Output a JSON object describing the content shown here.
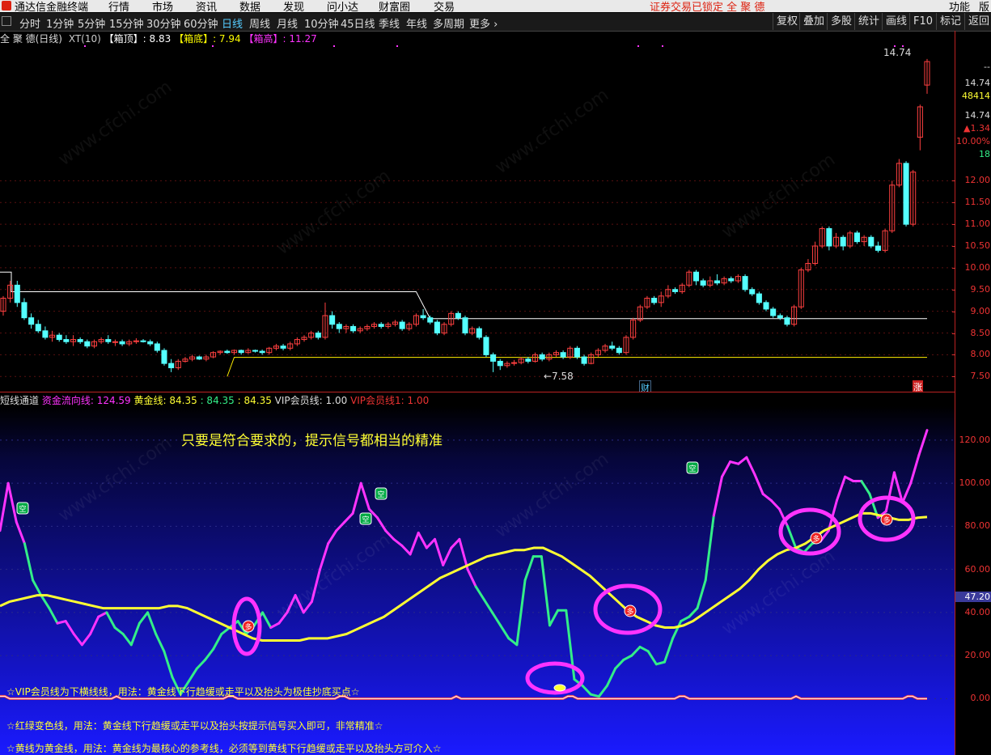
{
  "menu": {
    "app_name": "通达信金融终端",
    "items": [
      "行情",
      "市场",
      "资讯",
      "数据",
      "发现",
      "问小达",
      "财富圈",
      "交易"
    ],
    "status": "证券交易已锁定 全 聚 德",
    "right_items": [
      "功能",
      "版"
    ]
  },
  "toolbar": {
    "periods": [
      "分时",
      "1分钟",
      "5分钟",
      "15分钟",
      "30分钟",
      "60分钟",
      "日线",
      "周线",
      "月线",
      "10分钟",
      "45日线",
      "季线",
      "年线",
      "多周期",
      "更多"
    ],
    "active": "日线",
    "right_buttons": [
      "复权",
      "叠加",
      "多股",
      "统计",
      "画线",
      "F10",
      "标记",
      "返回"
    ]
  },
  "price_header": {
    "name": "全 聚 德(日线)",
    "indicator": "XT(10)",
    "top_label": "【箱顶】",
    "top_value": ": 8.83",
    "bottom_label": "【箱底】",
    "bottom_value": ": 7.94",
    "high_label": "【箱高】",
    "high_value": ": 11.27"
  },
  "price_chart": {
    "ymin": 7.3,
    "ymax": 15.3,
    "high_marker": "14.74",
    "low_marker": "←7.58",
    "event_cai": "财",
    "event_zhang": "涨",
    "box_top": 8.83,
    "box_bottom": 7.94,
    "old_box_top": 9.45,
    "up_color": "#ff4040",
    "down_color": "#54ffff",
    "candles": [
      [
        9.0,
        9.3,
        8.9,
        9.35
      ],
      [
        9.3,
        9.6,
        9.2,
        9.7
      ],
      [
        9.6,
        9.2,
        9.1,
        9.7
      ],
      [
        9.2,
        8.85,
        8.8,
        9.3
      ],
      [
        8.85,
        8.7,
        8.6,
        8.95
      ],
      [
        8.7,
        8.55,
        8.5,
        8.8
      ],
      [
        8.55,
        8.4,
        8.35,
        8.65
      ],
      [
        8.4,
        8.45,
        8.3,
        8.55
      ],
      [
        8.45,
        8.35,
        8.3,
        8.5
      ],
      [
        8.35,
        8.3,
        8.25,
        8.45
      ],
      [
        8.3,
        8.35,
        8.2,
        8.45
      ],
      [
        8.35,
        8.3,
        8.25,
        8.4
      ],
      [
        8.3,
        8.2,
        8.15,
        8.35
      ],
      [
        8.2,
        8.3,
        8.15,
        8.35
      ],
      [
        8.3,
        8.35,
        8.25,
        8.4
      ],
      [
        8.35,
        8.3,
        8.25,
        8.45
      ],
      [
        8.3,
        8.3,
        8.2,
        8.35
      ],
      [
        8.3,
        8.25,
        8.2,
        8.35
      ],
      [
        8.25,
        8.3,
        8.2,
        8.35
      ],
      [
        8.3,
        8.32,
        8.25,
        8.38
      ],
      [
        8.32,
        8.3,
        8.28,
        8.36
      ],
      [
        8.3,
        8.25,
        8.2,
        8.35
      ],
      [
        8.25,
        8.1,
        8.05,
        8.3
      ],
      [
        8.1,
        7.8,
        7.75,
        8.15
      ],
      [
        7.8,
        7.7,
        7.6,
        7.9
      ],
      [
        7.7,
        7.85,
        7.65,
        7.9
      ],
      [
        7.85,
        7.9,
        7.82,
        7.95
      ],
      [
        7.9,
        7.95,
        7.85,
        8.0
      ],
      [
        7.95,
        7.9,
        7.88,
        7.98
      ],
      [
        7.9,
        7.95,
        7.85,
        8.0
      ],
      [
        7.95,
        8.05,
        7.92,
        8.08
      ],
      [
        8.05,
        8.08,
        8.0,
        8.1
      ],
      [
        8.08,
        8.05,
        8.02,
        8.12
      ],
      [
        8.05,
        8.1,
        8.0,
        8.12
      ],
      [
        8.1,
        8.05,
        8.0,
        8.12
      ],
      [
        8.05,
        8.1,
        8.02,
        8.15
      ],
      [
        8.1,
        8.08,
        8.05,
        8.12
      ],
      [
        8.08,
        8.05,
        8.0,
        8.12
      ],
      [
        8.05,
        8.15,
        8.0,
        8.18
      ],
      [
        8.15,
        8.2,
        8.1,
        8.25
      ],
      [
        8.2,
        8.15,
        8.1,
        8.25
      ],
      [
        8.15,
        8.25,
        8.1,
        8.3
      ],
      [
        8.25,
        8.35,
        8.2,
        8.4
      ],
      [
        8.35,
        8.4,
        8.3,
        8.45
      ],
      [
        8.4,
        8.5,
        8.35,
        8.55
      ],
      [
        8.5,
        8.4,
        8.35,
        8.55
      ],
      [
        8.4,
        8.9,
        8.35,
        9.2
      ],
      [
        8.9,
        8.7,
        8.6,
        9.0
      ],
      [
        8.7,
        8.6,
        8.5,
        8.75
      ],
      [
        8.6,
        8.65,
        8.5,
        8.7
      ],
      [
        8.65,
        8.55,
        8.5,
        8.7
      ],
      [
        8.55,
        8.6,
        8.5,
        8.65
      ],
      [
        8.6,
        8.65,
        8.55,
        8.7
      ],
      [
        8.65,
        8.7,
        8.6,
        8.75
      ],
      [
        8.7,
        8.65,
        8.6,
        8.75
      ],
      [
        8.65,
        8.7,
        8.6,
        8.75
      ],
      [
        8.7,
        8.75,
        8.65,
        8.8
      ],
      [
        8.75,
        8.6,
        8.55,
        8.8
      ],
      [
        8.6,
        8.7,
        8.55,
        8.75
      ],
      [
        8.7,
        8.9,
        8.65,
        8.95
      ],
      [
        8.9,
        8.85,
        8.8,
        9.05
      ],
      [
        8.85,
        8.75,
        8.7,
        8.9
      ],
      [
        8.75,
        8.5,
        8.45,
        8.8
      ],
      [
        8.5,
        8.7,
        8.45,
        8.75
      ],
      [
        8.7,
        8.95,
        8.65,
        9.0
      ],
      [
        8.95,
        8.85,
        8.8,
        9.0
      ],
      [
        8.85,
        8.5,
        8.45,
        8.9
      ],
      [
        8.5,
        8.6,
        8.45,
        8.65
      ],
      [
        8.6,
        8.4,
        8.35,
        8.65
      ],
      [
        8.4,
        8.0,
        7.95,
        8.45
      ],
      [
        8.0,
        7.85,
        7.6,
        8.05
      ],
      [
        7.85,
        7.75,
        7.65,
        7.9
      ],
      [
        7.75,
        7.8,
        7.7,
        7.85
      ],
      [
        7.8,
        7.82,
        7.75,
        7.88
      ],
      [
        7.82,
        7.9,
        7.78,
        7.95
      ],
      [
        7.9,
        7.85,
        7.8,
        7.95
      ],
      [
        7.85,
        8.0,
        7.82,
        8.05
      ],
      [
        8.0,
        7.9,
        7.85,
        8.05
      ],
      [
        7.9,
        8.0,
        7.85,
        8.05
      ],
      [
        8.0,
        8.05,
        7.95,
        8.1
      ],
      [
        8.05,
        7.95,
        7.9,
        8.1
      ],
      [
        7.95,
        8.15,
        7.9,
        8.2
      ],
      [
        8.15,
        7.95,
        7.9,
        8.2
      ],
      [
        7.95,
        7.8,
        7.75,
        8.0
      ],
      [
        7.8,
        8.0,
        7.78,
        8.05
      ],
      [
        8.0,
        8.1,
        7.95,
        8.15
      ],
      [
        8.1,
        8.2,
        8.05,
        8.25
      ],
      [
        8.2,
        8.15,
        8.1,
        8.3
      ],
      [
        8.15,
        8.05,
        8.0,
        8.2
      ],
      [
        8.05,
        8.4,
        8.0,
        8.45
      ],
      [
        8.4,
        8.8,
        8.35,
        8.85
      ],
      [
        8.8,
        9.1,
        8.75,
        9.15
      ],
      [
        9.1,
        9.3,
        9.05,
        9.35
      ],
      [
        9.3,
        9.2,
        9.15,
        9.35
      ],
      [
        9.2,
        9.35,
        9.1,
        9.45
      ],
      [
        9.35,
        9.5,
        9.3,
        9.6
      ],
      [
        9.5,
        9.45,
        9.4,
        9.55
      ],
      [
        9.45,
        9.6,
        9.4,
        9.65
      ],
      [
        9.6,
        9.9,
        9.55,
        9.95
      ],
      [
        9.9,
        9.7,
        9.6,
        9.95
      ],
      [
        9.7,
        9.6,
        9.55,
        9.75
      ],
      [
        9.6,
        9.7,
        9.55,
        9.8
      ],
      [
        9.7,
        9.65,
        9.6,
        9.85
      ],
      [
        9.65,
        9.75,
        9.6,
        9.8
      ],
      [
        9.75,
        9.7,
        9.65,
        9.8
      ],
      [
        9.7,
        9.8,
        9.65,
        9.85
      ],
      [
        9.8,
        9.5,
        9.45,
        9.85
      ],
      [
        9.5,
        9.4,
        9.35,
        9.55
      ],
      [
        9.4,
        9.2,
        9.15,
        9.45
      ],
      [
        9.2,
        9.05,
        9.0,
        9.25
      ],
      [
        9.05,
        8.9,
        8.85,
        9.1
      ],
      [
        8.9,
        8.85,
        8.8,
        8.95
      ],
      [
        8.85,
        8.7,
        8.65,
        8.9
      ],
      [
        8.7,
        9.1,
        8.65,
        9.15
      ],
      [
        9.1,
        9.95,
        9.05,
        10.0
      ],
      [
        9.95,
        10.1,
        9.9,
        10.2
      ],
      [
        10.1,
        10.5,
        10.05,
        10.6
      ],
      [
        10.5,
        10.9,
        10.45,
        10.95
      ],
      [
        10.9,
        10.5,
        10.4,
        10.95
      ],
      [
        10.5,
        10.7,
        10.45,
        10.8
      ],
      [
        10.7,
        10.5,
        10.4,
        10.75
      ],
      [
        10.5,
        10.8,
        10.45,
        10.85
      ],
      [
        10.8,
        10.6,
        10.55,
        10.85
      ],
      [
        10.6,
        10.7,
        10.5,
        10.75
      ],
      [
        10.7,
        10.5,
        10.45,
        10.75
      ],
      [
        10.5,
        10.4,
        10.35,
        10.6
      ],
      [
        10.4,
        10.85,
        10.35,
        10.9
      ],
      [
        10.85,
        11.9,
        10.8,
        12.0
      ],
      [
        11.9,
        12.4,
        11.85,
        12.5
      ],
      [
        12.4,
        11.0,
        10.95,
        12.45
      ],
      [
        11.0,
        12.2,
        10.95,
        12.25
      ],
      [
        13.0,
        13.7,
        12.7,
        13.75
      ],
      [
        14.2,
        14.74,
        14.0,
        14.8
      ]
    ]
  },
  "price_axis": {
    "ticks": [
      12.0,
      11.5,
      11.0,
      10.5,
      10.0,
      9.5,
      9.0,
      8.5,
      8.0,
      7.5
    ],
    "labels": [
      "12.00",
      "11.50",
      "11.00",
      "10.50",
      "10.00",
      "9.50",
      "9.00",
      "8.50",
      "8.00",
      "7.50"
    ],
    "info": [
      "--",
      "14.74",
      "48414",
      "14.74",
      "▲1.34",
      "10.00%",
      "18"
    ]
  },
  "indicator_header": {
    "name": "短线通道",
    "fund_label": "资金流向线: 124.59",
    "gold_label": "黄金线: 84.35",
    "v1": ": 84.35",
    "v2": ": 84.35",
    "vip_label": "VIP会员线: 1.00",
    "vip1_label": "VIP会员线1: 1.00"
  },
  "indicator": {
    "ymin": -7,
    "ymax": 135,
    "title": "只要是符合要求的，提示信号都相当的精准",
    "ticks": [
      120,
      100,
      80,
      60,
      40,
      20,
      0
    ],
    "tick_labels": [
      "120.00",
      "100.00",
      "80.00",
      "60.00",
      "40.00",
      "20.00",
      "0.00"
    ],
    "current_label": "47.20",
    "current_value": 47.2,
    "signal_duo": "多",
    "signal_kong": "空",
    "fund_flow": [
      78,
      100,
      82,
      72,
      55,
      48,
      42,
      35,
      36,
      30,
      25,
      30,
      38,
      40,
      33,
      30,
      25,
      35,
      40,
      30,
      22,
      10,
      2,
      8,
      14,
      18,
      23,
      30,
      33,
      36,
      30,
      34,
      40,
      33,
      35,
      40,
      48,
      40,
      45,
      60,
      72,
      78,
      82,
      86,
      100,
      88,
      84,
      78,
      74,
      71,
      67,
      77,
      70,
      74,
      62,
      70,
      74,
      60,
      52,
      46,
      40,
      34,
      28,
      25,
      55,
      66,
      66,
      34,
      41,
      41,
      9,
      6,
      2,
      1,
      6,
      14,
      18,
      20,
      24,
      22,
      16,
      17,
      28,
      36,
      38,
      42,
      55,
      85,
      103,
      110,
      109,
      112,
      104,
      95,
      92,
      88,
      80,
      70,
      68,
      72,
      73,
      78,
      92,
      103,
      101,
      101,
      95,
      84,
      87,
      105,
      91,
      100,
      113,
      124.59
    ],
    "fund_green_ranges": [
      [
        3,
        7
      ],
      [
        13,
        33
      ],
      [
        58,
        87
      ],
      [
        96,
        100
      ],
      [
        105,
        107
      ]
    ],
    "gold": [
      43,
      45,
      46,
      47,
      48,
      48,
      47,
      46,
      45,
      44,
      43,
      42,
      42,
      42,
      42,
      42,
      42,
      42,
      43,
      43,
      42,
      40,
      38,
      36,
      34,
      32,
      30,
      28,
      27,
      27,
      27,
      27,
      27,
      28,
      28,
      28,
      29,
      30,
      32,
      34,
      36,
      38,
      41,
      44,
      47,
      50,
      53,
      56,
      58,
      60,
      62,
      64,
      66,
      67,
      68,
      69,
      69,
      70,
      70,
      68,
      66,
      63,
      60,
      57,
      53,
      49,
      45,
      41,
      38,
      36,
      34,
      33,
      33,
      34,
      36,
      39,
      42,
      45,
      48,
      51,
      55,
      60,
      64,
      67,
      69,
      70,
      72,
      75,
      78,
      80,
      82,
      84,
      86,
      86,
      85,
      84,
      83,
      83,
      84,
      84.35
    ]
  },
  "notes": [
    "☆VIP会员线为下横线线，用法：黄金线下行趋缓或走平以及抬头为极佳抄底买点☆",
    "☆红绿变色线，用法：黄金线下行趋缓或走平以及抬头按提示信号买入即可，非常精准☆",
    "☆黄线为黄金线，用法：黄金线为最核心的参考线，必须等到黄线下行趋缓或走平以及抬头方可介入☆"
  ],
  "watermark": "www.cfchi.com",
  "colors": {
    "fund_magenta": "#ff33ff",
    "fund_green": "#33ee88",
    "gold_yellow": "#ffff33",
    "signal_circle": "#ff33ff",
    "box_white": "#ffffff",
    "box_yellow": "#ffee00",
    "axis_red": "#dd3333"
  }
}
